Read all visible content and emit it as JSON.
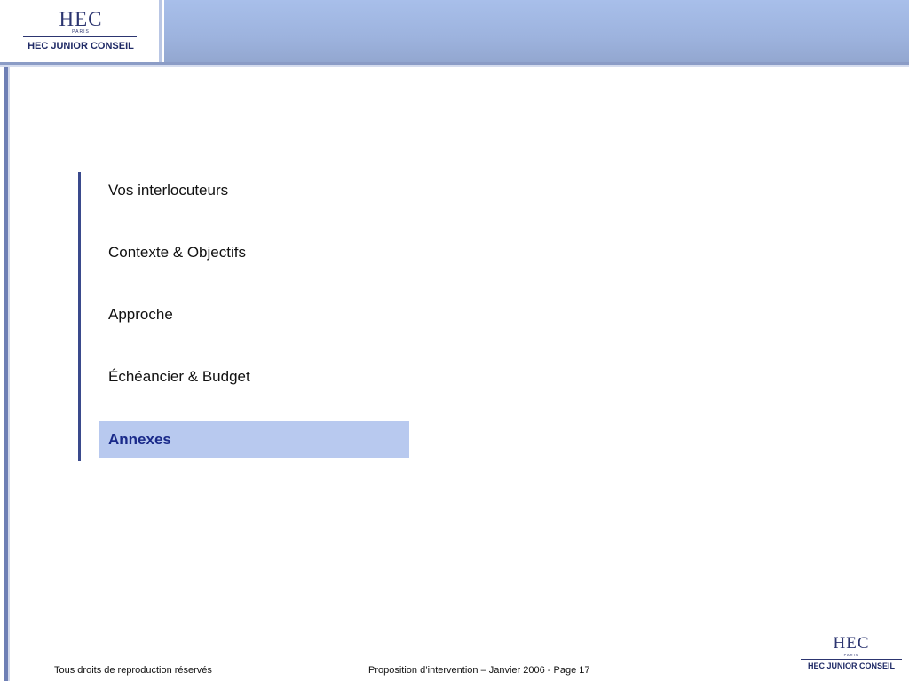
{
  "header": {
    "logo": {
      "wordmark": "HEC",
      "city": "PARIS",
      "name": "HEC JUNIOR CONSEIL"
    }
  },
  "agenda": {
    "items": [
      {
        "label": "Vos interlocuteurs"
      },
      {
        "label": "Contexte & Objectifs"
      },
      {
        "label": "Approche"
      },
      {
        "label": "Échéancier & Budget"
      },
      {
        "label": "Annexes",
        "active": true
      }
    ]
  },
  "footer": {
    "rights": "Tous droits de reproduction réservés",
    "document": "Proposition d’intervention – Janvier  2006 - Page 17",
    "logo": {
      "wordmark": "HEC",
      "city": "PARIS",
      "name": "HEC JUNIOR CONSEIL"
    }
  },
  "colors": {
    "header_band": "#9db3de",
    "accent": "#3a4a8c",
    "active_item_bg": "#b8c9ef",
    "active_item_text": "#1a2a8a"
  }
}
